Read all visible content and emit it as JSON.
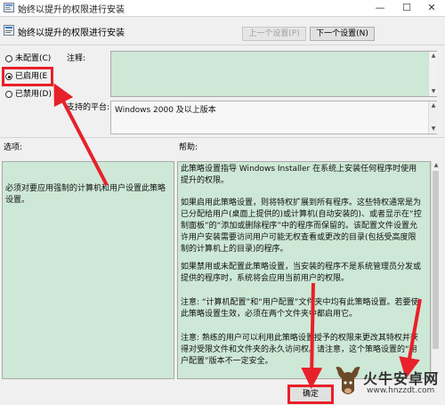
{
  "window": {
    "title": "始终以提升的权限进行安装",
    "minimize": "—",
    "maximize": "☐",
    "close": "✕"
  },
  "header": {
    "title": "始终以提升的权限进行安装",
    "prev_label": "上一个设置(P)",
    "next_label": "下一个设置(N)"
  },
  "options": {
    "not_configured": "未配置(C)",
    "enabled": "已启用(E",
    "disabled": "已禁用(D)",
    "selected": "enabled"
  },
  "comment": {
    "label": "注释:",
    "value": ""
  },
  "supported": {
    "label": "支持的平台:",
    "value": "Windows 2000 及以上版本"
  },
  "sections": {
    "options_label": "选项:",
    "help_label": "帮助:"
  },
  "options_text": "必须对要应用强制的计算机和用户设置此策略设置。",
  "help_paragraphs": [
    "此策略设置指导 Windows Installer 在系统上安装任何程序时使用提升的权限。",
    "如果启用此策略设置，则将特权扩展到所有程序。这些特权通常是为已分配给用户(桌面上提供的)或计算机(自动安装的)、或者显示在“控制面板”的“添加或删除程序”中的程序而保留的。该配置文件设置允许用户安装需要访问用户可能无权查看或更改的目录(包括受高度限制的计算机上的目录)的程序。",
    "如果禁用或未配置此策略设置，当安装的程序不是系统管理员分发或提供的程序时，系统将会应用当前用户的权限。",
    "注意: “计算机配置”和“用户配置”文件夹中均有此策略设置。若要使此策略设置生效，必须在两个文件夹中都启用它。",
    "注意: 熟练的用户可以利用此策略设置授予的权限来更改其特权并获得对受限文件和文件夹的永久访问权。请注意，这个策略设置的“用户配置”版本不一定安全。"
  ],
  "buttons": {
    "ok": "确定"
  },
  "watermark": {
    "name": "火牛安卓网",
    "url": "www.hnzzdt.com"
  },
  "colors": {
    "panel_green": "#cde8d6",
    "annotation_red": "#e8202a"
  }
}
